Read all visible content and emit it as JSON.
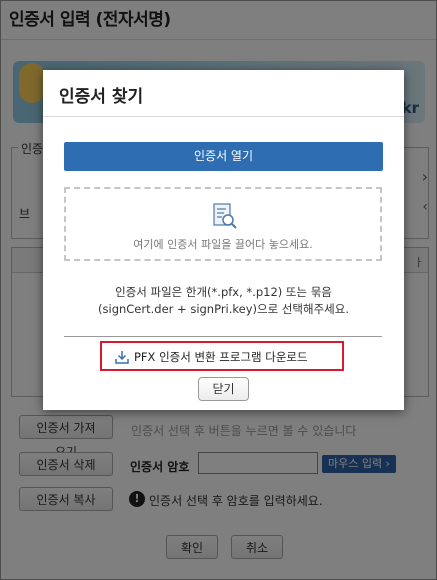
{
  "window": {
    "title": "인증서 입력 (전자서명)"
  },
  "banner": {
    "suffix": "kr"
  },
  "cert_group": {
    "legend": "인증",
    "small_label": "브"
  },
  "bg_buttons": {
    "import": "인증서 가져오기",
    "delete": "인증서 삭제",
    "copy": "인증서 복사",
    "ok": "확인",
    "cancel": "취소"
  },
  "bg_hint": "인증서 선택 후 버튼을 누르면 볼 수 있습니다",
  "password": {
    "label": "인증서 암호",
    "value": "",
    "mouse_input": "마우스 입력 ›"
  },
  "info": {
    "icon": "!",
    "text": "인증서 선택 후 암호를 입력하세요."
  },
  "dialog": {
    "title": "인증서 찾기",
    "open_button": "인증서 열기",
    "drop_hint": "여기에 인증서 파일을 끌어다 놓으세요.",
    "desc_line1": "인증서 파일은 한개(*.pfx, *.p12) 또는 묶음",
    "desc_line2": "(signCert.der + signPri.key)으로 선택해주세요.",
    "pfx_link": "PFX 인증서 변환 프로그램 다운로드",
    "close_button": "닫기"
  },
  "colors": {
    "primary": "#2f6db3",
    "highlight": "#d8192f",
    "overlay": "#00000080"
  },
  "icons": [
    "certificate-search-icon",
    "download-icon",
    "info-icon",
    "chevron-right-icon",
    "chevron-left-icon"
  ]
}
